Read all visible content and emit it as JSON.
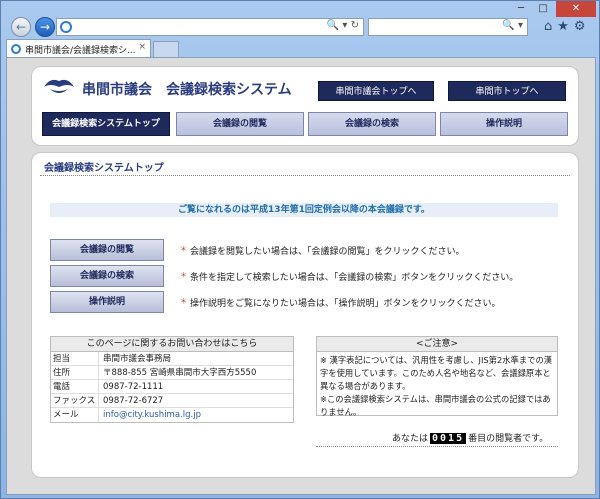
{
  "browser": {
    "tab_title": "串間市議会/会議録検索シ...",
    "tab_close": "×",
    "window_controls": {
      "min": "─",
      "max": "□",
      "close": "✕"
    },
    "address_tools": "🔍 ▾ ↻",
    "search_tools": "🔍 ▾",
    "right_icons": "⌂★⚙"
  },
  "header": {
    "site_title": "串間市議会　会議録検索システム",
    "top_links": [
      {
        "label": "串間市議会トップへ"
      },
      {
        "label": "串間市トップへ"
      }
    ],
    "menu": [
      {
        "label": "会議録検索システムトップ"
      },
      {
        "label": "会議録の閲覧"
      },
      {
        "label": "会議録の検索"
      },
      {
        "label": "操作説明"
      }
    ]
  },
  "main": {
    "title": "会議録検索システムトップ",
    "notice": "ご覧になれるのは平成13年第1回定例会以降の本会議録です。",
    "guides": [
      {
        "button": "会議録の閲覧",
        "desc": "会議録を閲覧したい場合は、「会議録の閲覧」をクリックください。"
      },
      {
        "button": "会議録の検索",
        "desc": "条件を指定して検索したい場合は、「会議録の検索」ボタンをクリックください。"
      },
      {
        "button": "操作説明",
        "desc": "操作説明をご覧になりたい場合は、「操作説明」ボタンをクリックください。"
      }
    ]
  },
  "contact": {
    "heading": "このページに関するお問い合わせはこちら",
    "rows": [
      {
        "key": "担当",
        "value": "串間市議会事務局"
      },
      {
        "key": "住所",
        "value": "〒888-855 宮崎県串間市大字西方5550"
      },
      {
        "key": "電話",
        "value": "0987-72-1111"
      },
      {
        "key": "ファックス",
        "value": "0987-72-6727"
      },
      {
        "key": "メール",
        "value": "info@city.kushima.lg.jp"
      }
    ]
  },
  "caution": {
    "heading": "<ご注意>",
    "lines": [
      "※ 漢字表記については、汎用性を考慮し、JIS第2水準までの漢字を使用しています。このため人名や地名など、会議録原本と異なる場合があります。",
      "※この会議録検索システムは、串間市議会の公式の記録ではありません。"
    ]
  },
  "counter": {
    "prefix": "あなたは",
    "digits": "0015",
    "suffix": "番目の閲覧者です。"
  },
  "colors": {
    "navy": "#1f2a5c",
    "accent_blue": "#1e6fa8",
    "title_blue": "#2b3d7e"
  }
}
